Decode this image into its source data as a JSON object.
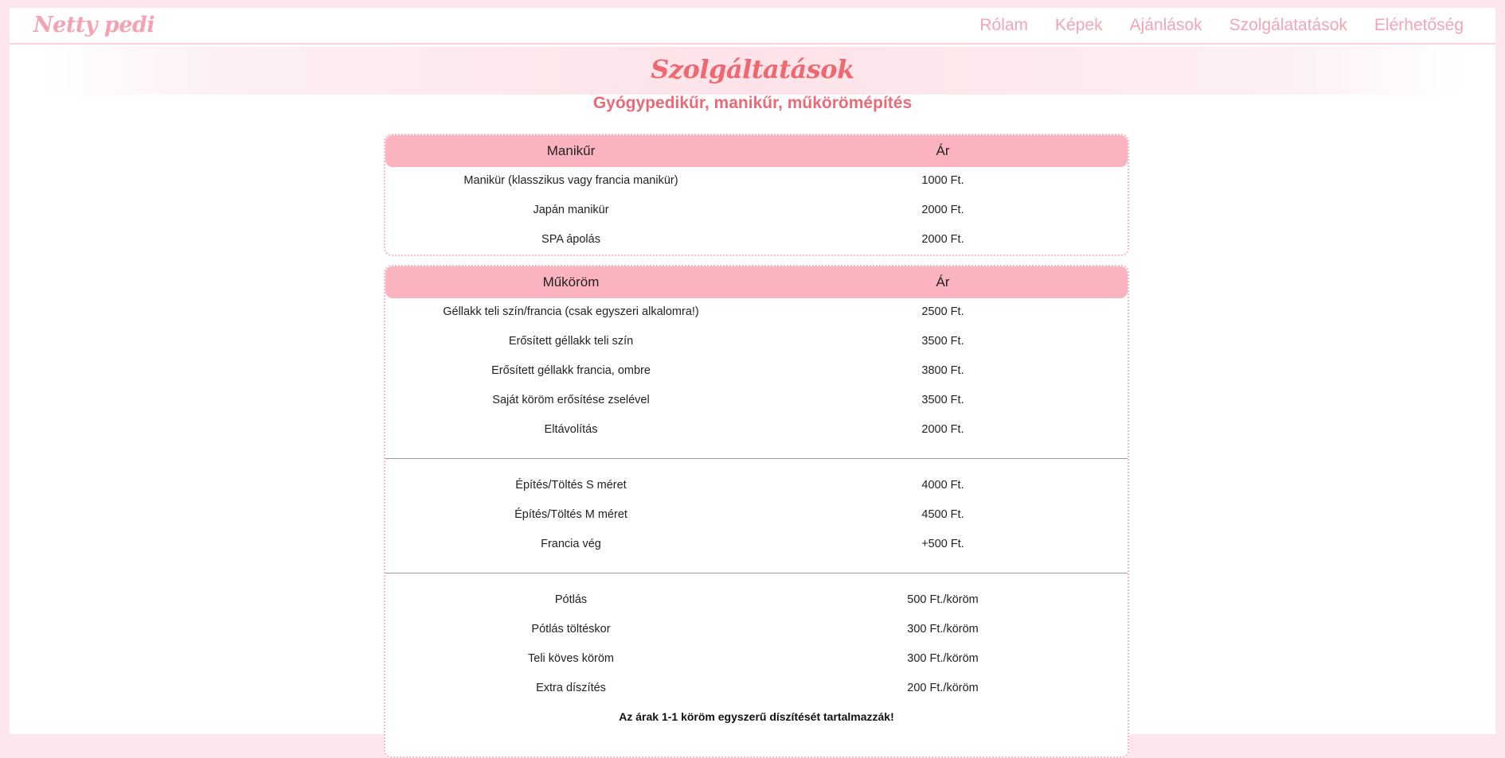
{
  "header": {
    "brand": "Netty pedi",
    "nav": [
      "Rólam",
      "Képek",
      "Ajánlások",
      "Szolgálatatások",
      "Elérhetőség"
    ]
  },
  "page_title": "Szolgáltatások",
  "subtitle": "Gyógypedikűr, manikűr, műkörömépítés",
  "manikur": {
    "header": {
      "name": "Manikűr",
      "price": "Ár"
    },
    "rows": [
      {
        "name": "Manikür (klasszikus vagy francia manikür)",
        "price": "1000 Ft."
      },
      {
        "name": "Japán manikür",
        "price": "2000 Ft."
      },
      {
        "name": "SPA ápolás",
        "price": "2000 Ft."
      }
    ]
  },
  "mukorom": {
    "header": {
      "name": "Műköröm",
      "price": "Ár"
    },
    "group1": [
      {
        "name": "Géllakk teli szín/francia (csak egyszeri alkalomra!)",
        "price": "2500 Ft."
      },
      {
        "name": "Erősített géllakk teli szín",
        "price": "3500 Ft."
      },
      {
        "name": "Erősített géllakk francia, ombre",
        "price": "3800 Ft."
      },
      {
        "name": "Saját köröm erősítése zselével",
        "price": "3500 Ft."
      },
      {
        "name": "Eltávolítás",
        "price": "2000 Ft."
      }
    ],
    "group2": [
      {
        "name": "Építés/Töltés S méret",
        "price": "4000 Ft."
      },
      {
        "name": "Építés/Töltés M méret",
        "price": "4500 Ft."
      },
      {
        "name": "Francia vég",
        "price": "+500 Ft."
      }
    ],
    "group3": [
      {
        "name": "Pótlás",
        "price": "500 Ft./köröm"
      },
      {
        "name": "Pótlás töltéskor",
        "price": "300 Ft./köröm"
      },
      {
        "name": "Teli köves köröm",
        "price": "300 Ft./köröm"
      },
      {
        "name": "Extra díszítés",
        "price": "200 Ft./köröm"
      }
    ],
    "note": "Az árak 1-1 köröm egyszerű díszítését tartalmazzák!"
  }
}
